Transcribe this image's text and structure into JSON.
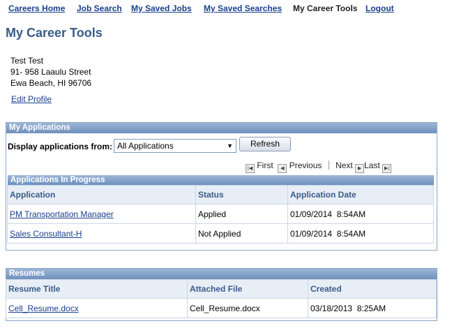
{
  "nav": {
    "careers_home": "Careers Home",
    "job_search": "Job Search",
    "saved_jobs": "My Saved Jobs",
    "saved_searches": "My Saved Searches",
    "career_tools": "My Career Tools",
    "logout": "Logout"
  },
  "page_title": "My Career Tools",
  "profile": {
    "name": "Test Test",
    "street": "91- 958 Laaulu Street",
    "city": "Ewa Beach, HI 96706",
    "edit_link": "Edit Profile"
  },
  "applications": {
    "header": "My Applications",
    "filter_label": "Display applications from:",
    "filter_value": "All Applications",
    "refresh": "Refresh",
    "pager": {
      "first": "First",
      "previous": "Previous",
      "next": "Next",
      "last": "Last"
    },
    "in_progress": {
      "header": "Applications In Progress",
      "columns": [
        "Application",
        "Status",
        "Application Date"
      ],
      "rows": [
        {
          "application": "PM Transportation Manager",
          "status": "Applied",
          "date": "01/09/2014  8:54AM"
        },
        {
          "application": "Sales Consultant-H",
          "status": "Not Applied",
          "date": "01/09/2014  8:54AM"
        }
      ]
    }
  },
  "resumes": {
    "header": "Resumes",
    "columns": [
      "Resume Title",
      "Attached File",
      "Created"
    ],
    "rows": [
      {
        "title": "Cell_Resume.docx",
        "file": "Cell_Resume.docx",
        "created": "03/18/2013  8:25AM"
      }
    ]
  },
  "colors": {
    "link": "#1a3f8c",
    "title": "#3a5b87",
    "header_bar": "#7f9dc5"
  }
}
